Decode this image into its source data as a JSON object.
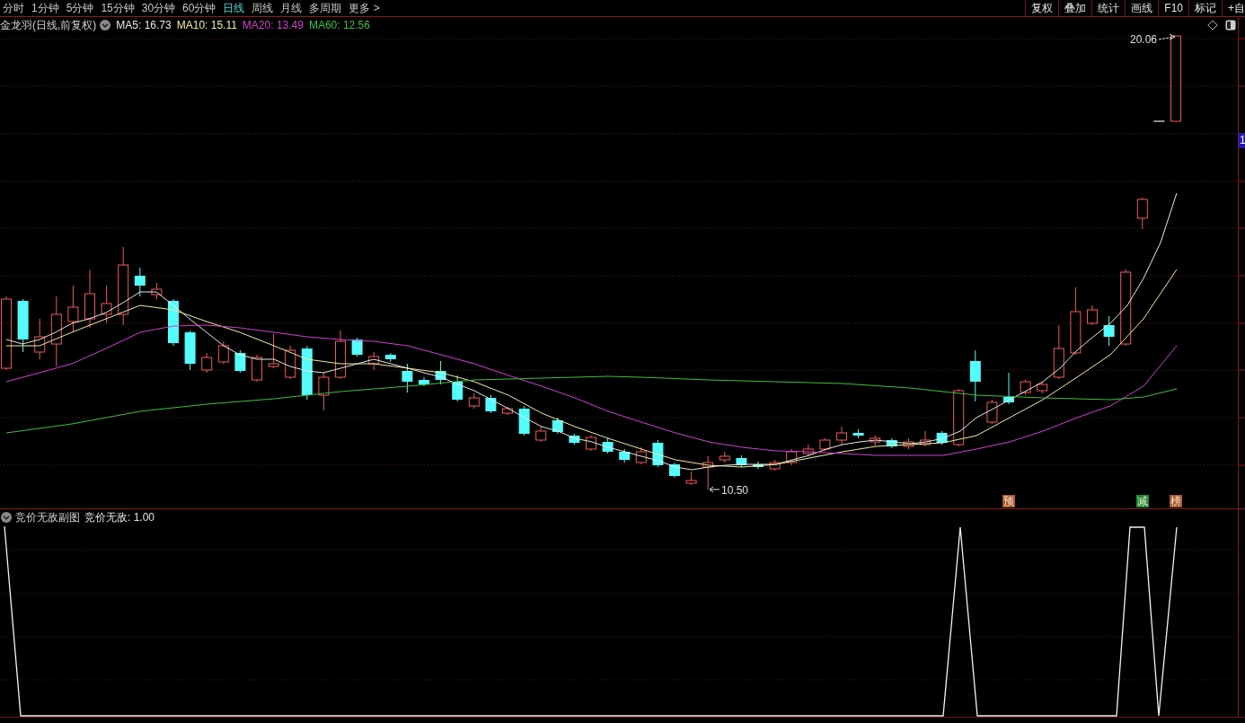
{
  "toolbar": {
    "periods": [
      {
        "label": "分时",
        "selected": false
      },
      {
        "label": "1分钟",
        "selected": false
      },
      {
        "label": "5分钟",
        "selected": false
      },
      {
        "label": "15分钟",
        "selected": false
      },
      {
        "label": "30分钟",
        "selected": false
      },
      {
        "label": "60分钟",
        "selected": false
      },
      {
        "label": "日线",
        "selected": true
      },
      {
        "label": "周线",
        "selected": false
      },
      {
        "label": "月线",
        "selected": false
      },
      {
        "label": "多周期",
        "selected": false
      },
      {
        "label": "更多 >",
        "selected": false
      }
    ],
    "actions": [
      "复权",
      "叠加",
      "统计",
      "画线",
      "F10",
      "标记",
      "+自"
    ]
  },
  "main_chart": {
    "title": "金龙羽(日线,前复权)",
    "indicators": [
      {
        "label": "MA5: 16.73",
        "color": "#e8e8e8"
      },
      {
        "label": "MA10: 15.11",
        "color": "#f2eca0"
      },
      {
        "label": "MA20: 13.49",
        "color": "#d040d0"
      },
      {
        "label": "MA60: 12.56",
        "color": "#3fc03f"
      }
    ],
    "high_label": "20.06",
    "low_label": "10.50",
    "axis_tag": "1",
    "signals": [
      {
        "label": "预",
        "color": "#a8582a"
      },
      {
        "label": "减",
        "color": "#1d8a36"
      },
      {
        "label": "榜",
        "color": "#a8582a"
      }
    ]
  },
  "sub_chart": {
    "title": "竞价无敌副图",
    "reading": "竞价无敌: 1.00"
  }
}
